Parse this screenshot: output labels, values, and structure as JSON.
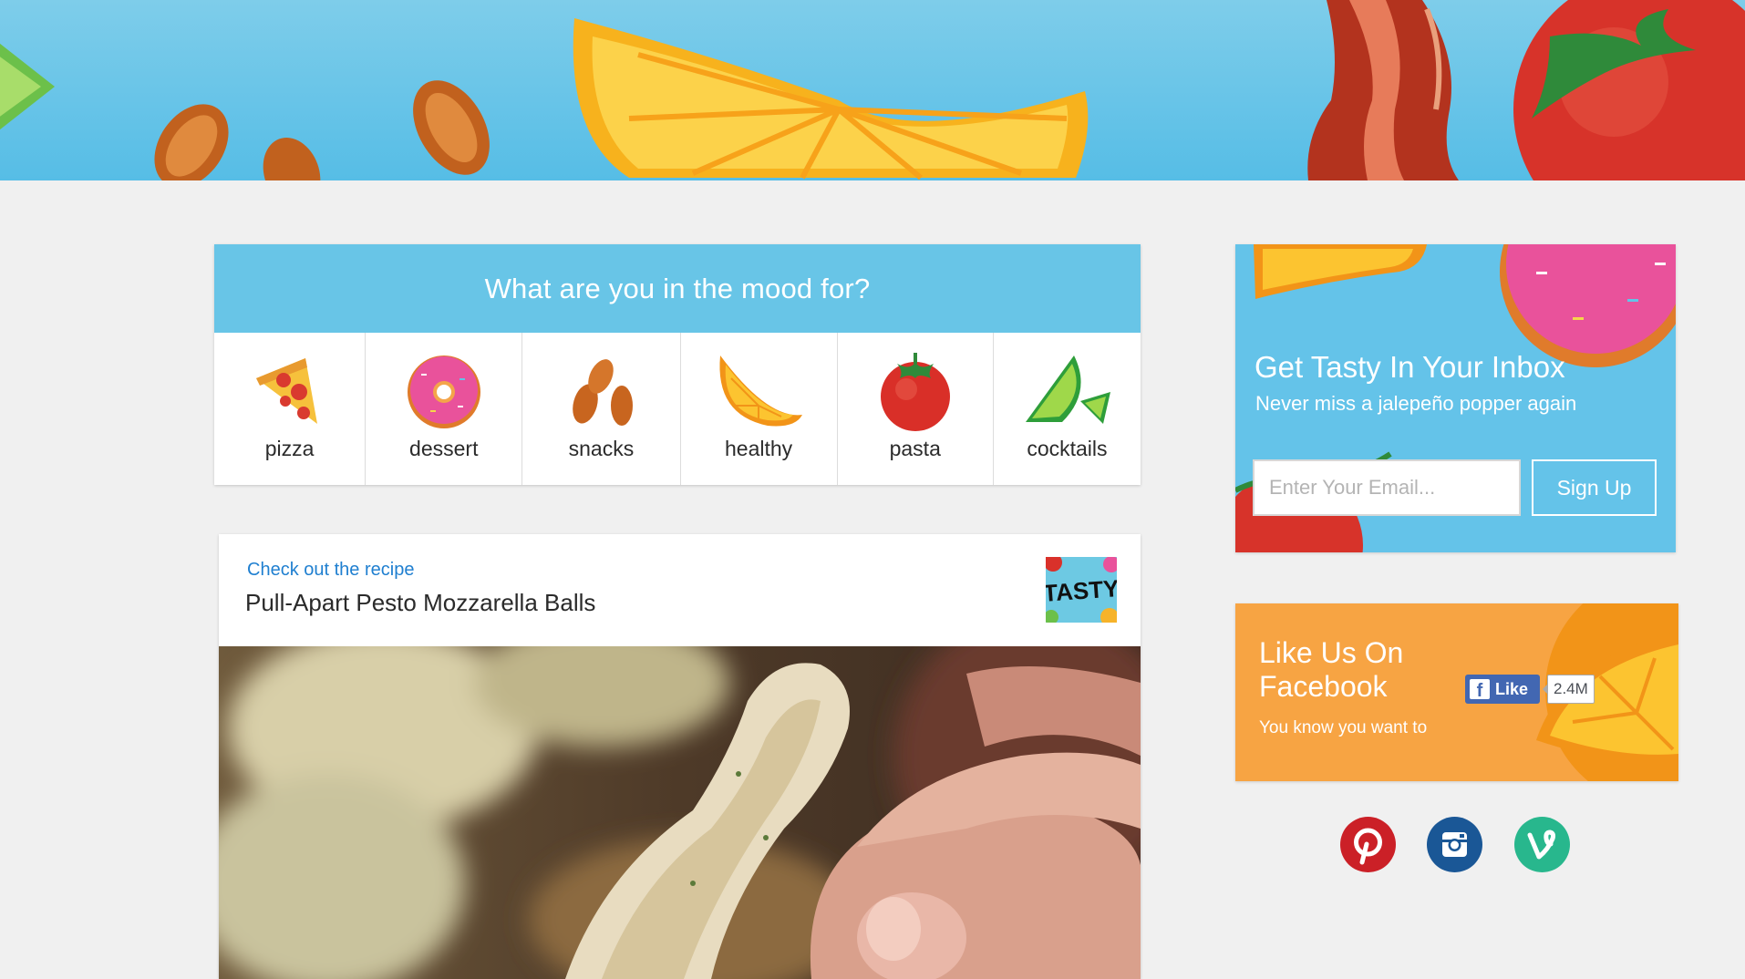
{
  "mood": {
    "heading": "What are you in the mood for?",
    "categories": [
      {
        "label": "pizza",
        "icon": "pizza-icon"
      },
      {
        "label": "dessert",
        "icon": "donut-icon"
      },
      {
        "label": "snacks",
        "icon": "almonds-icon"
      },
      {
        "label": "healthy",
        "icon": "orange-slice-icon"
      },
      {
        "label": "pasta",
        "icon": "tomato-icon"
      },
      {
        "label": "cocktails",
        "icon": "lime-icon"
      }
    ]
  },
  "recipe": {
    "kicker": "Check out the recipe",
    "title": "Pull-Apart Pesto Mozzarella Balls",
    "logo_text": "TASTY"
  },
  "newsletter": {
    "title": "Get Tasty In Your Inbox",
    "subtitle": "Never miss a jalepeño popper again",
    "email_placeholder": "Enter Your Email...",
    "signup_label": "Sign Up"
  },
  "facebook": {
    "title": "Like Us On Facebook",
    "subtitle": "You know you want to",
    "like_label": "Like",
    "like_count": "2.4M"
  },
  "social": [
    {
      "name": "pinterest",
      "icon": "pinterest-icon",
      "color": "#cb2027"
    },
    {
      "name": "instagram",
      "icon": "instagram-icon",
      "color": "#1a5796"
    },
    {
      "name": "vine",
      "icon": "vine-icon",
      "color": "#28b78d"
    }
  ],
  "colors": {
    "page_bg": "#f0f0f0",
    "mood_header": "#68c5e7",
    "newsletter_bg": "#64c3e9",
    "facebook_bg": "#f7a443",
    "link": "#1f7fd0"
  }
}
